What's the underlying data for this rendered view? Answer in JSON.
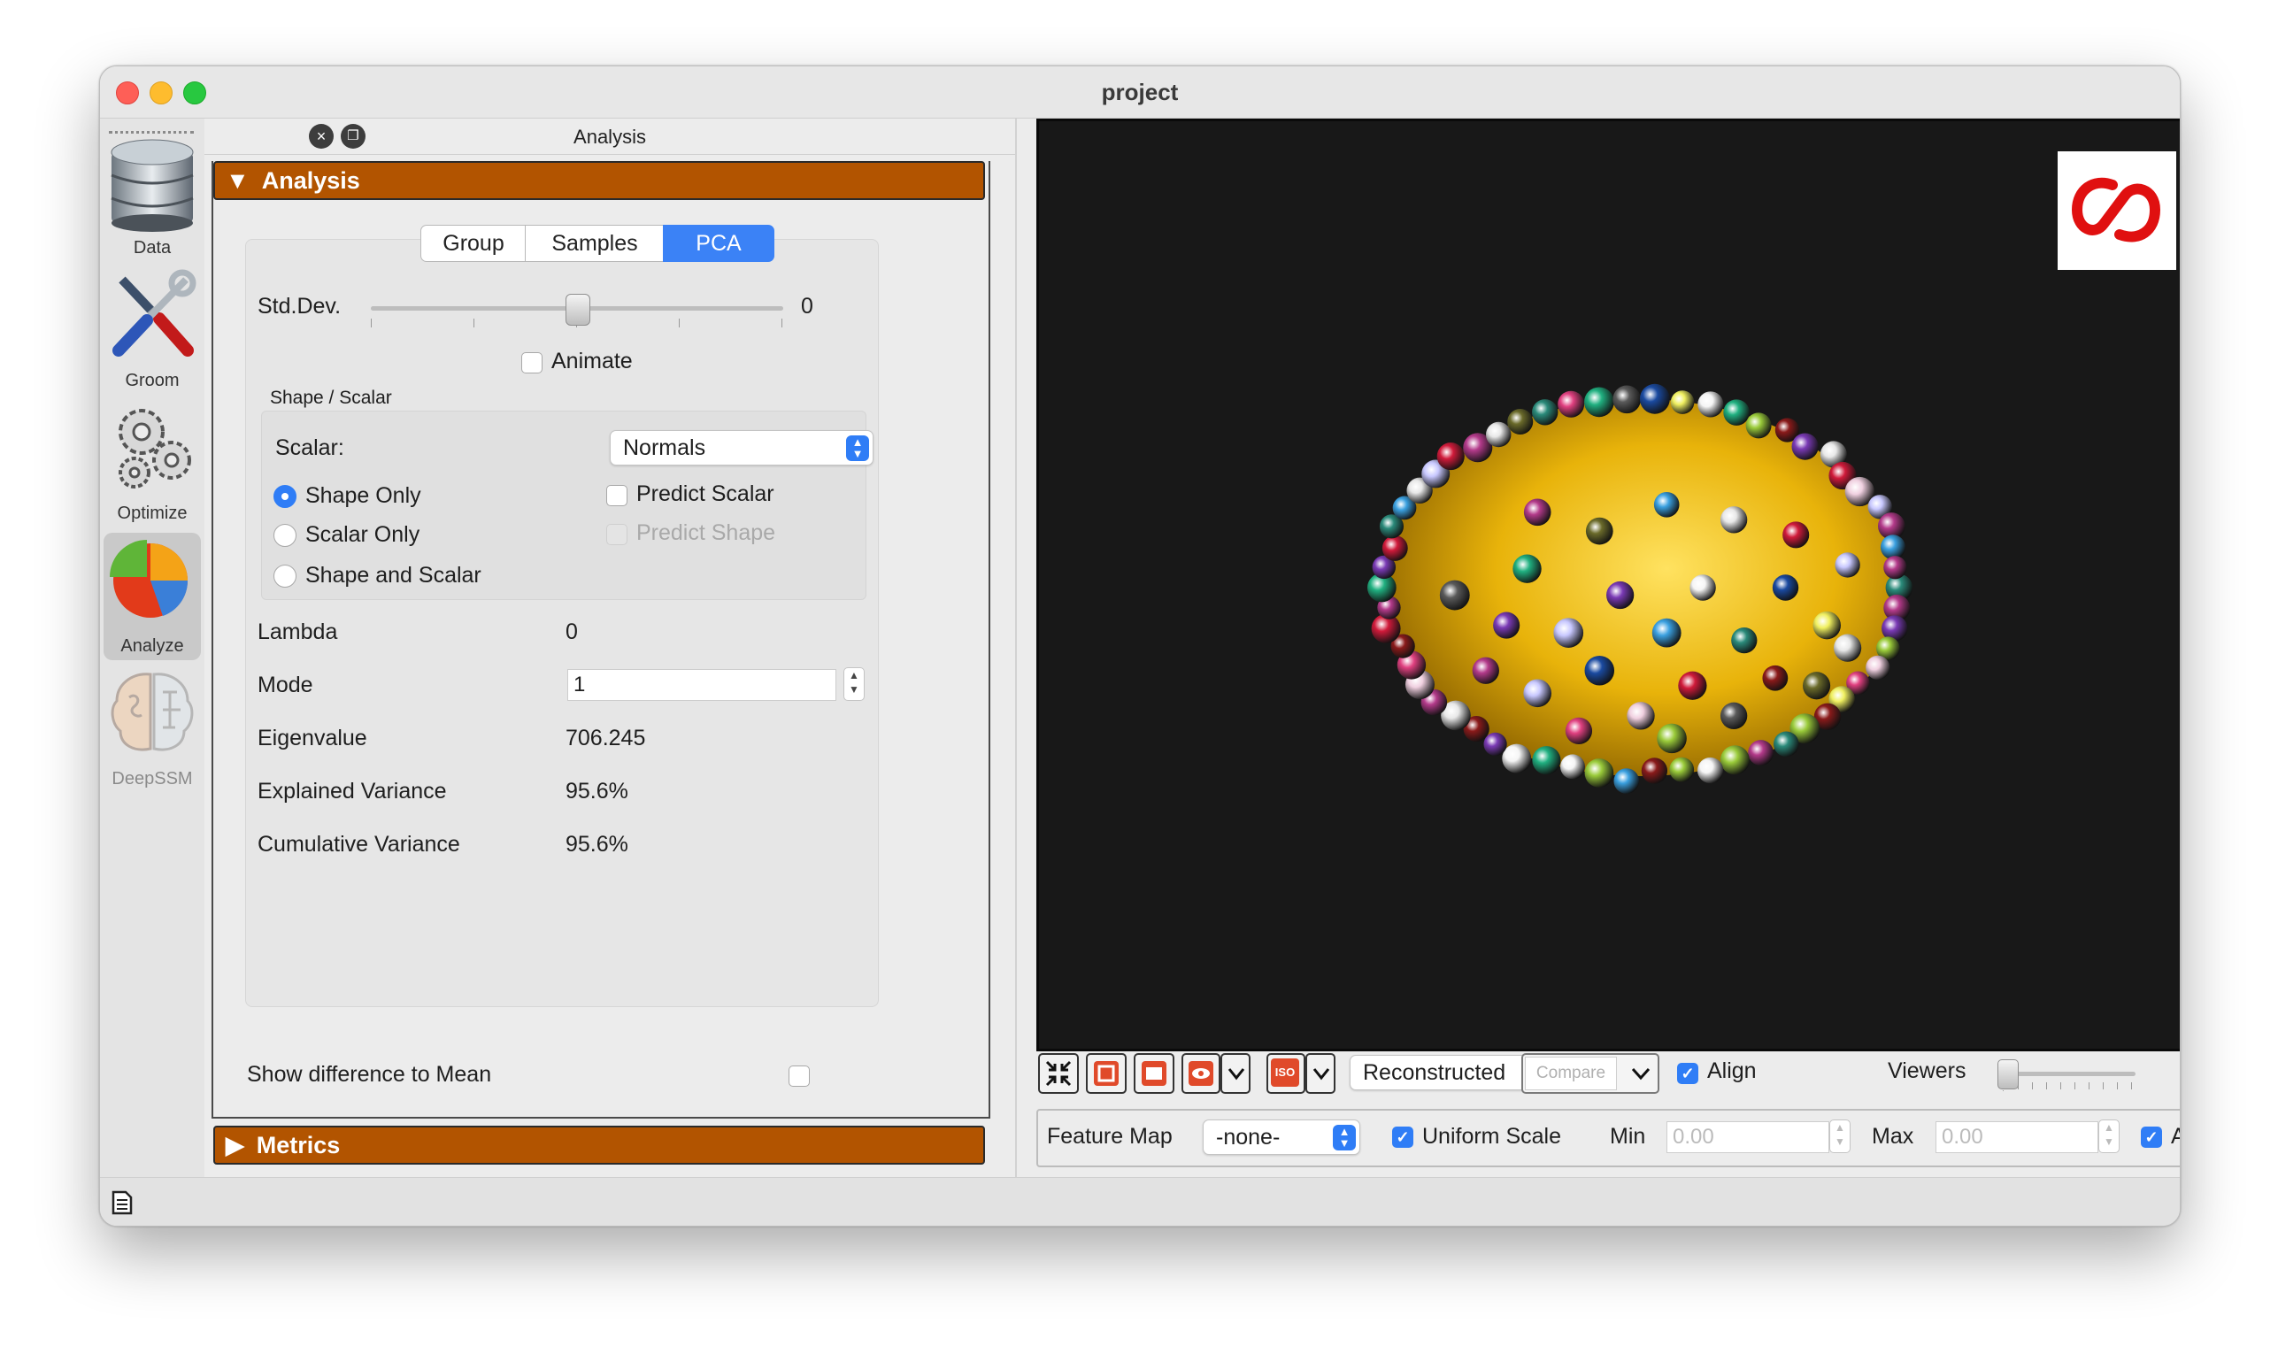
{
  "window": {
    "title": "project"
  },
  "tools": [
    {
      "label": "Data"
    },
    {
      "label": "Groom"
    },
    {
      "label": "Optimize"
    },
    {
      "label": "Analyze"
    },
    {
      "label": "DeepSSM"
    }
  ],
  "panel": {
    "title": "Analysis",
    "section_analysis": "Analysis",
    "section_metrics": "Metrics",
    "tabs": [
      "Group",
      "Samples",
      "PCA"
    ],
    "selected_tab": "PCA",
    "stddev_label": "Std.Dev.",
    "stddev_value": "0",
    "animate_label": "Animate",
    "shape_scalar_title": "Shape / Scalar",
    "scalar_label": "Scalar:",
    "scalar_value": "Normals",
    "radio_shape_only": "Shape Only",
    "radio_scalar_only": "Scalar Only",
    "radio_shape_and_scalar": "Shape and Scalar",
    "predict_scalar": "Predict Scalar",
    "predict_shape": "Predict Shape",
    "lambda_label": "Lambda",
    "lambda_value": "0",
    "mode_label": "Mode",
    "mode_value": "1",
    "eigenvalue_label": "Eigenvalue",
    "eigenvalue_value": "706.245",
    "explained_label": "Explained Variance",
    "explained_value": "95.6%",
    "cumulative_label": "Cumulative Variance",
    "cumulative_value": "95.6%",
    "show_diff_label": "Show difference to Mean"
  },
  "viewer_toolbar": {
    "display_mode": "Reconstructed",
    "compare_label": "Compare",
    "align_label": "Align",
    "viewers_label": "Viewers",
    "iso_label": "ISO"
  },
  "feature_bar": {
    "feature_map_label": "Feature Map",
    "feature_map_value": "-none-",
    "uniform_scale_label": "Uniform Scale",
    "min_label": "Min",
    "min_value": "0.00",
    "max_label": "Max",
    "max_value": "0.00",
    "auto_label": "Auto"
  },
  "colors": {
    "section_orange": "#b25400",
    "accent_blue": "#2f7df6",
    "viewer_bg": "#181818",
    "shape_gold": "#e8b30a"
  }
}
